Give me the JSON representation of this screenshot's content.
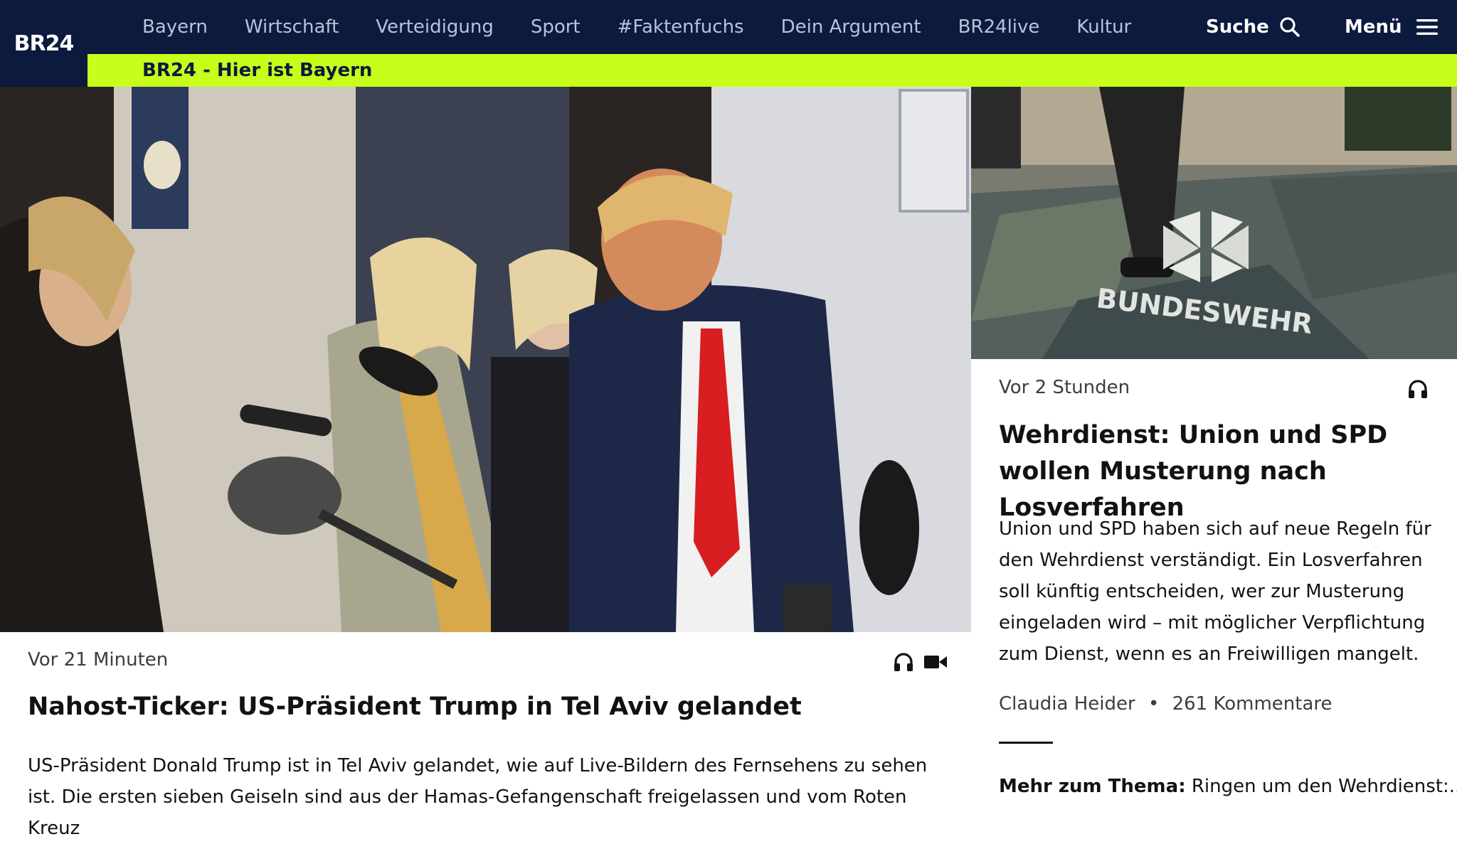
{
  "brand": {
    "logo": "BR24"
  },
  "nav": {
    "items": [
      "Bayern",
      "Wirtschaft",
      "Verteidigung",
      "Sport",
      "#Faktenfuchs",
      "Dein Argument",
      "BR24live",
      "Kultur"
    ],
    "search_label": "Suche",
    "search_icon": "search-icon",
    "menu_label": "Menü",
    "menu_icon": "hamburger-icon"
  },
  "subbar": {
    "label": "BR24 - Hier ist Bayern"
  },
  "colors": {
    "nav_bg": "#0b1a3d",
    "accent": "#c8ff1a"
  },
  "main_article": {
    "time": "Vor 21 Minuten",
    "media_icons": [
      "headphones-icon",
      "video-camera-icon"
    ],
    "headline": "Nahost-Ticker: US-Präsident Trump in Tel Aviv gelandet",
    "teaser": "US-Präsident Donald Trump ist in Tel Aviv gelandet, wie auf Live-Bildern des Fernsehens zu sehen ist. Die ersten sieben Geiseln sind aus der Hamas-Gefangenschaft freigelassen und vom Roten Kreuz"
  },
  "side_article": {
    "image_text": "BUNDESWEHR",
    "time": "Vor 2 Stunden",
    "media_icons": [
      "headphones-icon"
    ],
    "headline": "Wehrdienst: Union und SPD wollen Musterung nach Losverfahren",
    "teaser": "Union und SPD haben sich auf neue Regeln für den Wehrdienst verständigt. Ein Losverfahren soll künftig entscheiden, wer zur Musterung eingeladen wird – mit möglicher Verpflichtung zum Dienst, wenn es an Freiwilligen mangelt.",
    "author": "Claudia Heider",
    "separator": "•",
    "comments": "261 Kommentare",
    "more_label": "Mehr zum Thema:",
    "more_text": "Ringen um den Wehrdienst:..."
  }
}
